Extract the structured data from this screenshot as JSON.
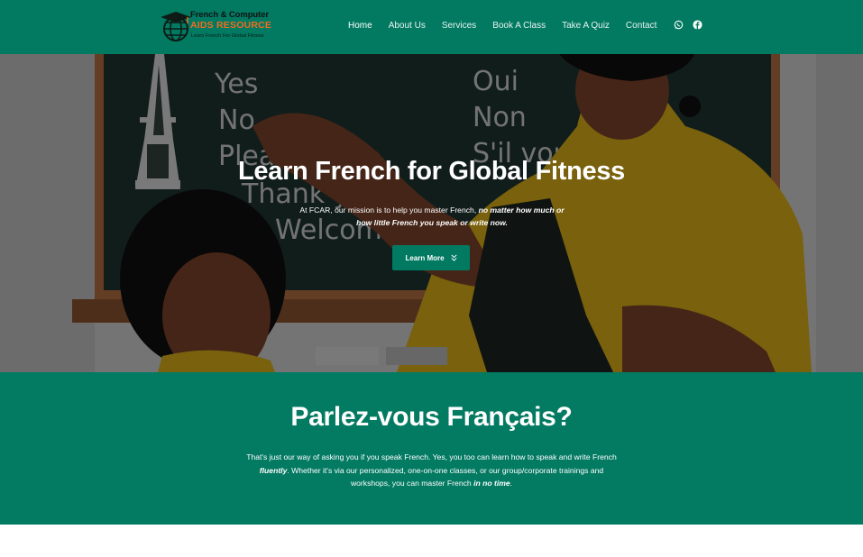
{
  "brand": {
    "name_line1": "French & Computer",
    "name_line2": "AIDS RESOURCE",
    "tagline": "Learn French For Global Fitness"
  },
  "nav": {
    "items": [
      "Home",
      "About Us",
      "Services",
      "Book A Class",
      "Take A Quiz",
      "Contact"
    ],
    "active": "Home",
    "social_icons": [
      "whatsapp-icon",
      "facebook-icon"
    ]
  },
  "hero": {
    "title": "Learn French for Global Fitness",
    "text_plain": "At FCAR, our mission is to help you master French, ",
    "text_emphasis": "no matter how much or how little French you speak or write now.",
    "button_label": "Learn More",
    "board_words_left": [
      "Yes",
      "No",
      "Please",
      "Thank you",
      "Welcome"
    ],
    "board_words_right": [
      "Oui",
      "Non",
      "S'il vous"
    ]
  },
  "section": {
    "title": "Parlez-vous Français?",
    "p1": "That's just our way of asking you if you speak French. Yes, you too can learn how to speak and write French ",
    "p1_em": "fluently",
    "p2": ". Whether it's via our personalized, one-on-one classes, or our group/corporate trainings and workshops, you can master French ",
    "p2_em": "in no time",
    "p3": "."
  },
  "colors": {
    "brand_green": "#027a62",
    "accent_orange": "#f26b1d",
    "white": "#ffffff"
  }
}
